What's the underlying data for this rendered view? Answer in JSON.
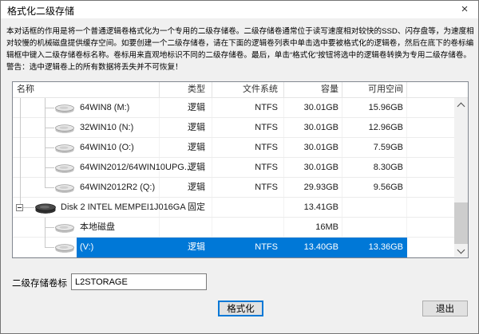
{
  "window": {
    "title": "格式化二级存储",
    "close_glyph": "×"
  },
  "description": {
    "lines": [
      "本对话框的作用是将一个普通逻辑卷格式化为一个专用的二级存储卷。二级存储卷通常位于读写速度相对较快的SSD、闪存盘等，为速度相",
      "对较慢的机械磁盘提供缓存空间。如要创建一个二级存储卷，请在下面的逻辑卷列表中单击选中要被格式化的逻辑卷，然后在底下的卷标编",
      "辑框中键入二级存储卷标名称。卷标用来直观地标识不同的二级存储卷。最后，单击“格式化”按钮将选中的逻辑卷转换为专用二级存储卷。",
      "警告：选中逻辑卷上的所有数据将丢失并不可恢复！"
    ]
  },
  "table": {
    "headers": [
      "名称",
      "类型",
      "文件系统",
      "容量",
      "可用空间"
    ],
    "rows": [
      {
        "name": "64WIN8 (M:)",
        "type": "逻辑",
        "fs": "NTFS",
        "capacity": "30.01GB",
        "free": "15.96GB",
        "kind": "volume",
        "root_line": "full",
        "child_line": "full",
        "selected": false
      },
      {
        "name": "32WIN10 (N:)",
        "type": "逻辑",
        "fs": "NTFS",
        "capacity": "30.01GB",
        "free": "12.96GB",
        "kind": "volume",
        "root_line": "full",
        "child_line": "full",
        "selected": false
      },
      {
        "name": "64WIN10 (O:)",
        "type": "逻辑",
        "fs": "NTFS",
        "capacity": "30.01GB",
        "free": "7.59GB",
        "kind": "volume",
        "root_line": "full",
        "child_line": "full",
        "selected": false
      },
      {
        "name": "64WIN2012/64WIN10UPG...",
        "type": "逻辑",
        "fs": "NTFS",
        "capacity": "30.01GB",
        "free": "8.30GB",
        "kind": "volume",
        "root_line": "full",
        "child_line": "full",
        "selected": false
      },
      {
        "name": "64WIN2012R2 (Q:)",
        "type": "逻辑",
        "fs": "NTFS",
        "capacity": "29.93GB",
        "free": "9.56GB",
        "kind": "volume",
        "root_line": "full",
        "child_line": "last",
        "selected": false
      },
      {
        "name": "Disk 2 INTEL MEMPEI1J016GA",
        "type": "固定",
        "fs": "",
        "capacity": "13.41GB",
        "free": "",
        "kind": "disk",
        "root_line": "end",
        "expander": "collapsed",
        "selected": false
      },
      {
        "name": "本地磁盘",
        "type": "",
        "fs": "",
        "capacity": "16MB",
        "free": "",
        "kind": "volume",
        "child_line": "full",
        "selected": false
      },
      {
        "name": "(V:)",
        "type": "逻辑",
        "fs": "NTFS",
        "capacity": "13.40GB",
        "free": "13.36GB",
        "kind": "volume",
        "child_line": "last",
        "selected": true
      }
    ]
  },
  "volume_label_field": {
    "label": "二级存储卷标",
    "value": "L2STORAGE"
  },
  "buttons": {
    "format": "格式化",
    "exit": "退出"
  },
  "colors": {
    "selection": "#0078d7",
    "titlebar_bg": "#ffffff",
    "dialog_bg": "#f0f0f0"
  }
}
